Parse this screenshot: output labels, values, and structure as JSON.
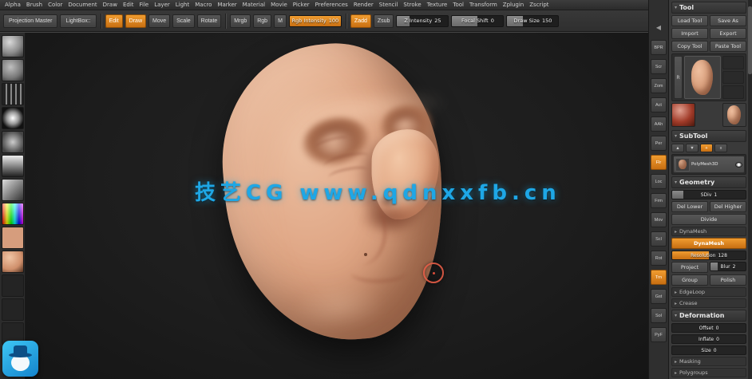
{
  "colors": {
    "accent_orange": "#e08a1e",
    "watermark_blue": "#1ea7e6"
  },
  "watermark": {
    "text": "技艺CG www.qdnxxfb.cn"
  },
  "menu_bar": {
    "items": [
      "Alpha",
      "Brush",
      "Color",
      "Document",
      "Draw",
      "Edit",
      "File",
      "Layer",
      "Light",
      "Macro",
      "Marker",
      "Material",
      "Movie",
      "Picker",
      "Preferences",
      "Render",
      "Stencil",
      "Stroke",
      "Texture",
      "Tool",
      "Transform",
      "Zplugin",
      "Zscript"
    ]
  },
  "shelf": {
    "projection_master": "Projection Master",
    "lightbox": "LightBox::",
    "mode_buttons": [
      {
        "name": "edit-mode-button",
        "label": "Edit",
        "active": true
      },
      {
        "name": "draw-mode-button",
        "label": "Draw",
        "active": true
      },
      {
        "name": "move-mode-button",
        "label": "Move",
        "active": false
      },
      {
        "name": "scale-mode-button",
        "label": "Scale",
        "active": false
      },
      {
        "name": "rotate-mode-button",
        "label": "Rotate",
        "active": false
      }
    ],
    "paint_buttons": [
      {
        "name": "mrgb-button",
        "label": "Mrgb",
        "active": false
      },
      {
        "name": "rgb-button",
        "label": "Rgb",
        "active": false
      },
      {
        "name": "m-button",
        "label": "M",
        "active": false
      }
    ],
    "rgb_intensity": {
      "label": "Rgb Intensity",
      "value": 100,
      "pct": 100
    },
    "sculpt_buttons": [
      {
        "name": "zadd-button",
        "label": "Zadd",
        "active": true
      },
      {
        "name": "zsub-button",
        "label": "Zsub",
        "active": false
      }
    ],
    "sliders": [
      {
        "name": "z-intensity-slider",
        "label": "Z Intensity",
        "value": 25,
        "pct": 25
      },
      {
        "name": "focal-shift-slider",
        "label": "Focal Shift",
        "value": 0,
        "pct": 50
      },
      {
        "name": "draw-size-slider",
        "label": "Draw Size",
        "value": 150,
        "pct": 30
      }
    ]
  },
  "left_tray": {
    "items": [
      {
        "name": "brush-thumbnail",
        "cls": "t-brush"
      },
      {
        "name": "brush-preview-thumbnail",
        "cls": "t-brush2"
      },
      {
        "name": "stroke-thumbnail",
        "cls": "t-stroke"
      },
      {
        "name": "alpha-thumbnail",
        "cls": "t-alpha1"
      },
      {
        "name": "alpha-thumbnail",
        "cls": "t-alpha2"
      },
      {
        "name": "alpha-thumbnail",
        "cls": "t-alpha3"
      },
      {
        "name": "alpha-thumbnail",
        "cls": "t-alpha4"
      },
      {
        "name": "color-picker",
        "cls": "t-picker"
      },
      {
        "name": "color-swatch",
        "cls": "t-swatch"
      },
      {
        "name": "material-thumbnail",
        "cls": "t-material"
      },
      {
        "name": "texture-thumbnail",
        "cls": "t-texture"
      },
      {
        "name": "texture-thumbnail",
        "cls": "t-texture"
      },
      {
        "name": "texture-thumbnail",
        "cls": "t-texture"
      }
    ]
  },
  "right_shelf": {
    "collapse": "◀",
    "items": [
      {
        "name": "bpr-render-button",
        "glyph": "BPR",
        "active": false
      },
      {
        "name": "scroll-button",
        "glyph": "Scr",
        "active": false
      },
      {
        "name": "zoom-button",
        "glyph": "Zom",
        "active": false
      },
      {
        "name": "actual-size-button",
        "glyph": "Act",
        "active": false
      },
      {
        "name": "aa-half-button",
        "glyph": "AAh",
        "active": false
      },
      {
        "name": "perspective-button",
        "glyph": "Per",
        "active": false
      },
      {
        "name": "floor-grid-button",
        "glyph": "Flr",
        "active": true
      },
      {
        "name": "local-symmetry-button",
        "glyph": "Loc",
        "active": false
      },
      {
        "name": "frame-button",
        "glyph": "Frm",
        "active": false
      },
      {
        "name": "move-view-button",
        "glyph": "Mov",
        "active": false
      },
      {
        "name": "scale-view-button",
        "glyph": "Scl",
        "active": false
      },
      {
        "name": "rotate-view-button",
        "glyph": "Rot",
        "active": false
      },
      {
        "name": "transparency-button",
        "glyph": "Trn",
        "active": true
      },
      {
        "name": "ghost-button",
        "glyph": "Gst",
        "active": false
      },
      {
        "name": "solo-button",
        "glyph": "Sol",
        "active": false
      },
      {
        "name": "polyframe-button",
        "glyph": "PyF",
        "active": false
      }
    ]
  },
  "tool_panel": {
    "title": "Tool",
    "load_tool": "Load Tool",
    "save_as": "Save As",
    "import": "Import",
    "export": "Export",
    "copy_tool": "Copy Tool",
    "paste_tool": "Paste Tool",
    "r_label": "R",
    "subtool": {
      "title": "SubTool",
      "item_name": "PolyMesh3D",
      "tools": [
        {
          "name": "subtool-up-button",
          "glyph": "▲"
        },
        {
          "name": "subtool-down-button",
          "glyph": "▼"
        },
        {
          "name": "subtool-duplicate-button",
          "glyph": "+",
          "active": true
        },
        {
          "name": "subtool-delete-button",
          "glyph": "x"
        }
      ]
    },
    "geometry": {
      "title": "Geometry",
      "sdiv_label": "SDiv",
      "sdiv_value": 1,
      "sdiv_pct": 15,
      "del_lower": "Del Lower",
      "del_higher": "Del Higher",
      "divide": "Divide",
      "dynamesh_title": "DynaMesh",
      "dynamesh": "DynaMesh",
      "resolution_label": "Resolution",
      "resolution_value": 128,
      "resolution_pct": 50,
      "project": "Project",
      "blur_label": "Blur",
      "blur_value": 2,
      "blur_pct": 20,
      "group": "Group",
      "polish": "Polish",
      "edgeloop_title": "EdgeLoop",
      "crease_title": "Crease"
    },
    "deformation": {
      "title": "Deformation",
      "offset_label": "Offset",
      "offset_value": 0,
      "offset_pct": 0,
      "inflate_label": "Inflate",
      "inflate_value": 0,
      "inflate_pct": 0,
      "size_label": "Size",
      "size_value": 0,
      "size_pct": 0,
      "masking_title": "Masking",
      "polygroups_title": "Polygroups"
    }
  }
}
